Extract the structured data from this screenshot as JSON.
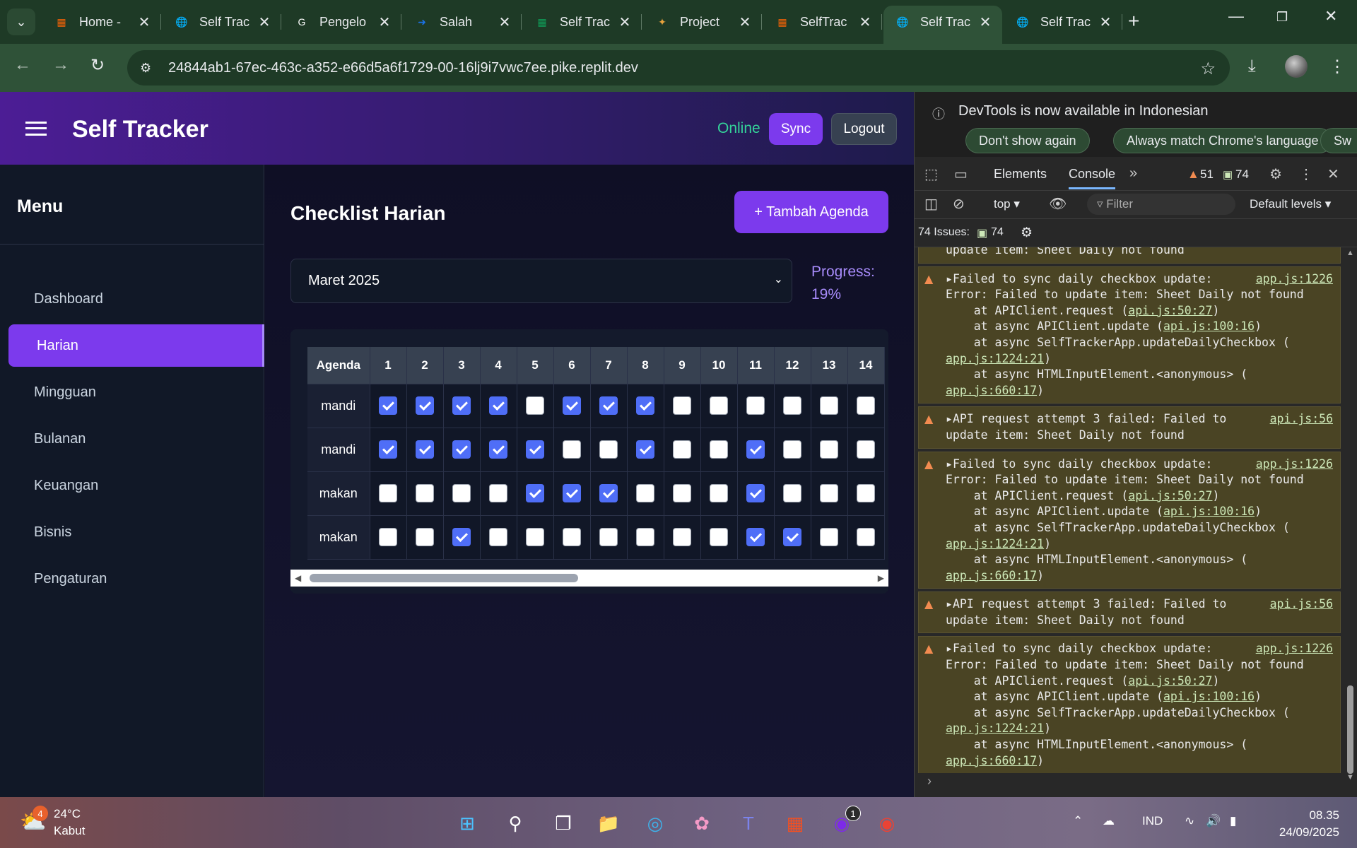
{
  "browser": {
    "tabs": [
      {
        "label": "Home -",
        "icon": "replit-icon",
        "color": "#f26207"
      },
      {
        "label": "Self Trac",
        "icon": "globe-icon",
        "color": "#cccccc"
      },
      {
        "label": "Pengelo",
        "icon": "google-icon",
        "color": "#ffffff"
      },
      {
        "label": "Salah",
        "icon": "arrow-icon",
        "color": "#1a73e8"
      },
      {
        "label": "Self Trac",
        "icon": "sheets-icon",
        "color": "#0f9d58"
      },
      {
        "label": "Project",
        "icon": "gemini-icon",
        "color": "#e8a33d"
      },
      {
        "label": "SelfTrac",
        "icon": "replit-icon",
        "color": "#f26207"
      },
      {
        "label": "Self Trac",
        "icon": "globe-icon",
        "color": "#cccccc"
      },
      {
        "label": "Self Trac",
        "icon": "globe-icon",
        "color": "#cccccc"
      }
    ],
    "active_tab_index": 7,
    "url": "24844ab1-67ec-463c-a352-e66d5a6f1729-00-16lj9i7vwc7ee.pike.replit.dev"
  },
  "app": {
    "title": "Self Tracker",
    "status": "Online",
    "sync_label": "Sync",
    "logout_label": "Logout",
    "menu_title": "Menu",
    "menu": [
      "Dashboard",
      "Harian",
      "Mingguan",
      "Bulanan",
      "Keuangan",
      "Bisnis",
      "Pengaturan"
    ],
    "active_menu": "Harian",
    "page_title": "Checklist Harian",
    "add_label": "+ Tambah Agenda",
    "month": "Maret 2025",
    "progress_label": "Progress:",
    "progress_value": "19%",
    "table": {
      "header": "Agenda",
      "days": [
        "1",
        "2",
        "3",
        "4",
        "5",
        "6",
        "7",
        "8",
        "9",
        "10",
        "11",
        "12",
        "13",
        "14"
      ],
      "rows": [
        {
          "agenda": "mandi",
          "checks": [
            1,
            1,
            1,
            1,
            0,
            1,
            1,
            1,
            0,
            0,
            0,
            0,
            0,
            0
          ]
        },
        {
          "agenda": "mandi",
          "checks": [
            1,
            1,
            1,
            1,
            1,
            0,
            0,
            1,
            0,
            0,
            1,
            0,
            0,
            0
          ]
        },
        {
          "agenda": "makan",
          "checks": [
            0,
            0,
            0,
            0,
            1,
            1,
            1,
            0,
            0,
            0,
            1,
            0,
            0,
            0
          ]
        },
        {
          "agenda": "makan",
          "checks": [
            0,
            0,
            1,
            0,
            0,
            0,
            0,
            0,
            0,
            0,
            1,
            1,
            0,
            0
          ]
        }
      ]
    }
  },
  "devtools": {
    "banner_text": "DevTools is now available in Indonesian",
    "dont_show": "Don't show again",
    "always_match": "Always match Chrome's language",
    "switch_partial": "Sw",
    "tabs": [
      "Elements",
      "Console"
    ],
    "active_tab": "Console",
    "warn_count": "51",
    "msg_count": "74",
    "context": "top",
    "filter_placeholder": "Filter",
    "levels": "Default levels",
    "issues_label": "74 Issues:",
    "issues_count": "74",
    "partial_line": "update item: Sheet Daily not found",
    "messages": [
      {
        "type": "sync",
        "title": "Failed to sync daily checkbox update:",
        "src": "app.js:1226",
        "error": "Error: Failed to update item: Sheet Daily not found",
        "stack": [
          {
            "pre": "    at APIClient.request (",
            "link": "api.js:50:27",
            "post": ")"
          },
          {
            "pre": "    at async APIClient.update (",
            "link": "api.js:100:16",
            "post": ")"
          },
          {
            "pre": "    at async SelfTrackerApp.updateDailyCheckbox (",
            "link": "",
            "post": ""
          },
          {
            "pre": "",
            "link": "app.js:1224:21",
            "post": ")"
          },
          {
            "pre": "    at async HTMLInputElement.<anonymous> (",
            "link": "",
            "post": ""
          },
          {
            "pre": "",
            "link": "app.js:660:17",
            "post": ")"
          }
        ]
      },
      {
        "type": "api",
        "title": "API request attempt 3 failed: Failed to",
        "src": "api.js:56",
        "cont": "update item: Sheet Daily not found"
      },
      {
        "type": "sync",
        "title": "Failed to sync daily checkbox update:",
        "src": "app.js:1226",
        "error": "Error: Failed to update item: Sheet Daily not found",
        "stack": [
          {
            "pre": "    at APIClient.request (",
            "link": "api.js:50:27",
            "post": ")"
          },
          {
            "pre": "    at async APIClient.update (",
            "link": "api.js:100:16",
            "post": ")"
          },
          {
            "pre": "    at async SelfTrackerApp.updateDailyCheckbox (",
            "link": "",
            "post": ""
          },
          {
            "pre": "",
            "link": "app.js:1224:21",
            "post": ")"
          },
          {
            "pre": "    at async HTMLInputElement.<anonymous> (",
            "link": "",
            "post": ""
          },
          {
            "pre": "",
            "link": "app.js:660:17",
            "post": ")"
          }
        ]
      },
      {
        "type": "api",
        "title": "API request attempt 3 failed: Failed to",
        "src": "api.js:56",
        "cont": "update item: Sheet Daily not found"
      },
      {
        "type": "sync",
        "title": "Failed to sync daily checkbox update:",
        "src": "app.js:1226",
        "error": "Error: Failed to update item: Sheet Daily not found",
        "stack": [
          {
            "pre": "    at APIClient.request (",
            "link": "api.js:50:27",
            "post": ")"
          },
          {
            "pre": "    at async APIClient.update (",
            "link": "api.js:100:16",
            "post": ")"
          },
          {
            "pre": "    at async SelfTrackerApp.updateDailyCheckbox (",
            "link": "",
            "post": ""
          },
          {
            "pre": "",
            "link": "app.js:1224:21",
            "post": ")"
          },
          {
            "pre": "    at async HTMLInputElement.<anonymous> (",
            "link": "",
            "post": ""
          },
          {
            "pre": "",
            "link": "app.js:660:17",
            "post": ")"
          }
        ]
      }
    ]
  },
  "taskbar": {
    "temp": "24°C",
    "weather": "Kabut",
    "weather_badge": "4",
    "canva_badge": "1",
    "lang": "IND",
    "time": "08.35",
    "date": "24/09/2025"
  }
}
